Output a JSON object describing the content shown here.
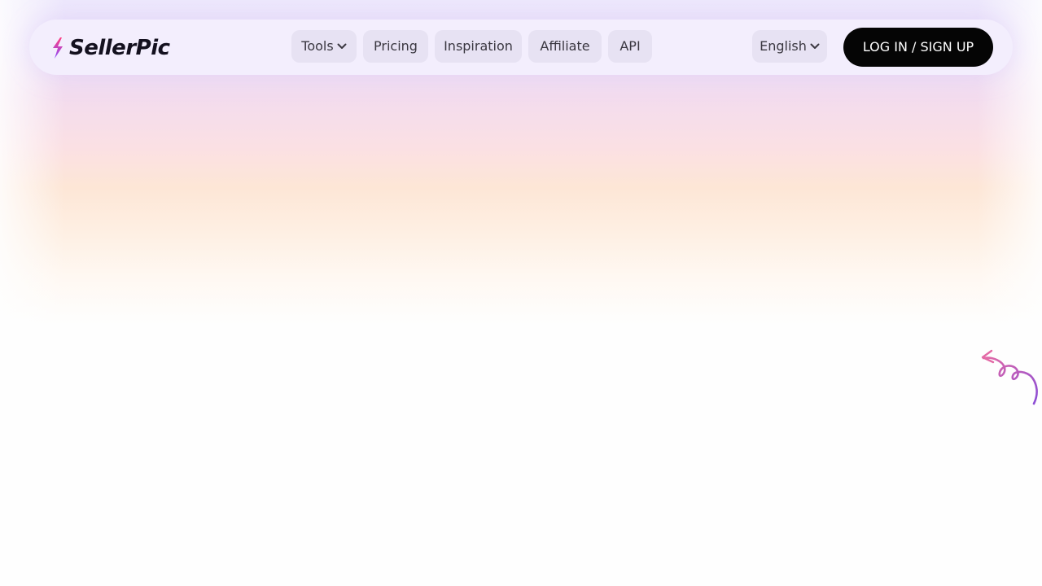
{
  "brand": {
    "name": "SellerPic",
    "logo_gradient": [
      "#ff3d7f",
      "#8a4dff"
    ],
    "text_color": "#14111f"
  },
  "nav": {
    "tools_label": "Tools",
    "pricing_label": "Pricing",
    "inspiration_label": "Inspiration",
    "affiliate_label": "Affiliate",
    "api_label": "API",
    "language_label": "English",
    "login_label": "LOG IN / SIGN UP",
    "pill_color": "#e7e2f3",
    "button_color": "#050505"
  },
  "decoration": {
    "squiggle_colors": [
      "#e36aa6",
      "#8a4dd6"
    ],
    "squiggle_icon": "curly-arrow-icon"
  }
}
